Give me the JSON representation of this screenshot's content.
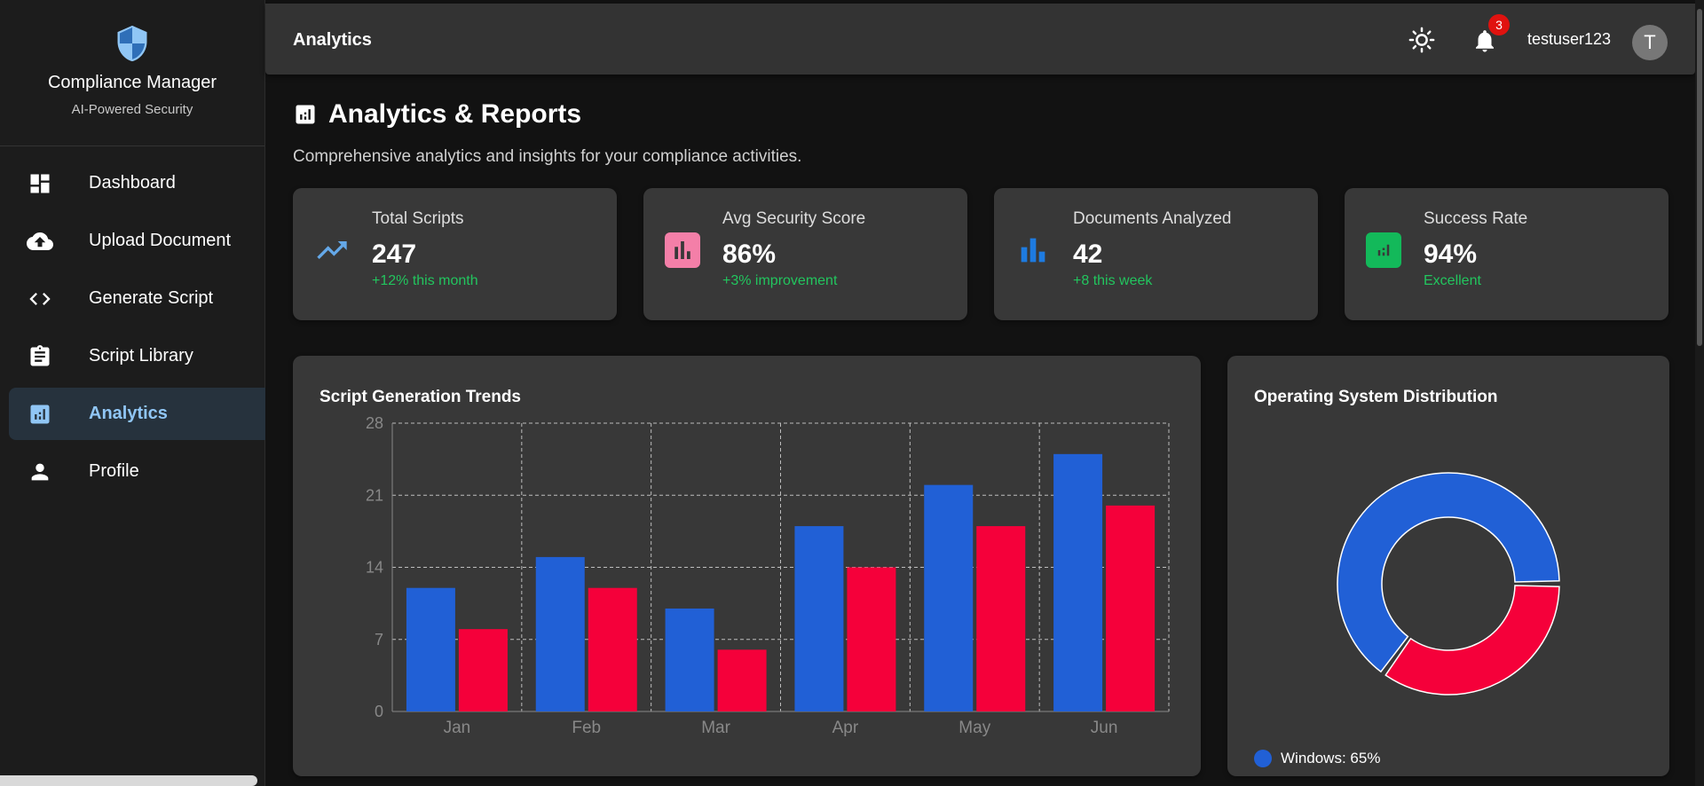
{
  "brand": {
    "title": "Compliance Manager",
    "subtitle": "AI-Powered Security"
  },
  "nav": [
    {
      "label": "Dashboard",
      "icon": "dashboard-icon"
    },
    {
      "label": "Upload Document",
      "icon": "cloud-upload-icon"
    },
    {
      "label": "Generate Script",
      "icon": "code-icon"
    },
    {
      "label": "Script Library",
      "icon": "clipboard-icon"
    },
    {
      "label": "Analytics",
      "icon": "analytics-icon",
      "active": true
    },
    {
      "label": "Profile",
      "icon": "person-icon"
    }
  ],
  "topbar": {
    "page_name": "Analytics",
    "notifications": "3",
    "username": "testuser123",
    "avatar_initial": "T"
  },
  "page": {
    "title": "Analytics & Reports",
    "description": "Comprehensive analytics and insights for your compliance activities."
  },
  "stats": [
    {
      "label": "Total Scripts",
      "value": "247",
      "sub": "+12% this month",
      "icon": "trending-up-icon",
      "color": "#64a8e8"
    },
    {
      "label": "Avg Security Score",
      "value": "86%",
      "sub": "+3% improvement",
      "icon": "bar-chart-icon",
      "color": "#f47fa8"
    },
    {
      "label": "Documents Analyzed",
      "value": "42",
      "sub": "+8 this week",
      "icon": "bar-chart-icon",
      "color": "#1e7be0"
    },
    {
      "label": "Success Rate",
      "value": "94%",
      "sub": "Excellent",
      "icon": "analytics-icon",
      "color": "#13b95a"
    }
  ],
  "trends_title": "Script Generation Trends",
  "os_title": "Operating System Distribution",
  "os_legend": [
    {
      "label": "Windows: 65%",
      "color": "#2160d6"
    }
  ],
  "chart_data": [
    {
      "type": "bar",
      "title": "Script Generation Trends",
      "categories": [
        "Jan",
        "Feb",
        "Mar",
        "Apr",
        "May",
        "Jun"
      ],
      "series": [
        {
          "values": [
            12,
            15,
            10,
            18,
            22,
            25
          ],
          "color": "#2160d6"
        },
        {
          "values": [
            8,
            12,
            6,
            14,
            18,
            20
          ],
          "color": "#f5003a"
        }
      ],
      "ylim": [
        0,
        28
      ],
      "yticks": [
        0,
        7,
        14,
        21,
        28
      ],
      "grid": true
    },
    {
      "type": "pie",
      "title": "Operating System Distribution",
      "donut": true,
      "slices": [
        {
          "label": "Windows",
          "value": 65,
          "color": "#2160d6"
        },
        {
          "value": 35,
          "color": "#f5003a"
        }
      ]
    }
  ]
}
